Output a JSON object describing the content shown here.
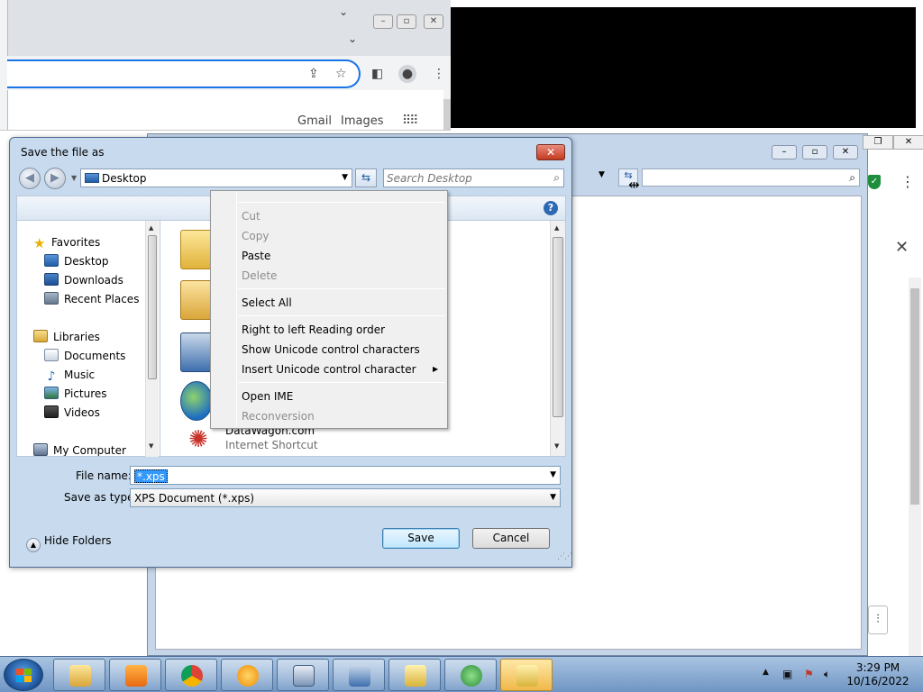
{
  "background": {
    "chrome_links": {
      "gmail": "Gmail",
      "images": "Images"
    }
  },
  "dialog": {
    "title": "Save the file as",
    "location": "Desktop",
    "search_placeholder": "Search Desktop",
    "nav": {
      "favorites": "Favorites",
      "desktop": "Desktop",
      "downloads": "Downloads",
      "recent_places": "Recent Places",
      "libraries": "Libraries",
      "documents": "Documents",
      "music": "Music",
      "pictures": "Pictures",
      "videos": "Videos",
      "my_computer": "My Computer"
    },
    "files": {
      "last_name": "DataWagon.com",
      "last_type": "Internet Shortcut"
    },
    "file_name_label": "File name:",
    "file_name_value": "*.xps",
    "save_type_label": "Save as type:",
    "save_type_value": "XPS Document (*.xps)",
    "hide_folders": "Hide Folders",
    "save_button": "Save",
    "cancel_button": "Cancel"
  },
  "context_menu": {
    "cut": "Cut",
    "copy": "Copy",
    "paste": "Paste",
    "delete": "Delete",
    "select_all": "Select All",
    "rtl": "Right to left Reading order",
    "show_unicode": "Show Unicode control characters",
    "insert_unicode": "Insert Unicode control character",
    "open_ime": "Open IME",
    "reconversion": "Reconversion"
  },
  "taskbar": {
    "time": "3:29 PM",
    "date": "10/16/2022"
  },
  "colors": {
    "dialog_frame": "#c7daee",
    "selection": "#3399ff",
    "taskbar": "#6f95c3",
    "close_red": "#c53a22"
  }
}
